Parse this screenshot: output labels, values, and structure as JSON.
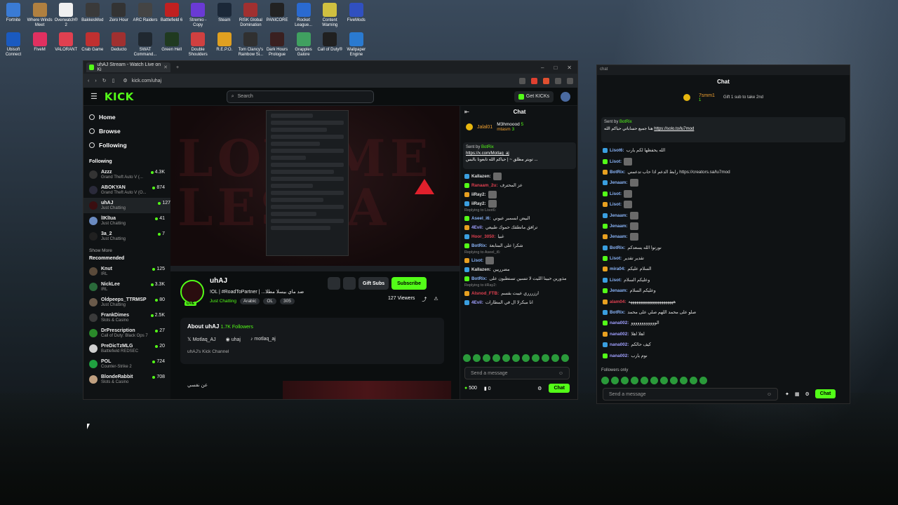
{
  "desktop": {
    "icons": [
      {
        "label": "Fortnite",
        "color": "#3a7bd5"
      },
      {
        "label": "Where Winds Meet",
        "color": "#b08040"
      },
      {
        "label": "Overwatch® 2",
        "color": "#f0f0f0"
      },
      {
        "label": "BakkesMod",
        "color": "#3a3a3a"
      },
      {
        "label": "Zero Hour",
        "color": "#333"
      },
      {
        "label": "ARC Raiders",
        "color": "#444"
      },
      {
        "label": "Battlefield 6",
        "color": "#c02020"
      },
      {
        "label": "Stremio - Copy",
        "color": "#6a3ad5"
      },
      {
        "label": "Steam",
        "color": "#1b2838"
      },
      {
        "label": "RISK Global Domination",
        "color": "#a03030"
      },
      {
        "label": "PANICORE",
        "color": "#222"
      },
      {
        "label": "Rocket League...",
        "color": "#2a6ad0"
      },
      {
        "label": "Content Warning",
        "color": "#d0c040"
      },
      {
        "label": "FiveMods",
        "color": "#3050c0"
      },
      {
        "label": "Ubisoft Connect",
        "color": "#1a5ac0"
      },
      {
        "label": "FiveM",
        "color": "#e03060"
      },
      {
        "label": "VALORANT",
        "color": "#e04050"
      },
      {
        "label": "Crab Game",
        "color": "#c03030"
      },
      {
        "label": "Deducto",
        "color": "#a03030"
      },
      {
        "label": "SWAT Command...",
        "color": "#202830"
      },
      {
        "label": "Green Hell",
        "color": "#203a20"
      },
      {
        "label": "Double Shoulders",
        "color": "#d04040"
      },
      {
        "label": "R.E.P.O.",
        "color": "#e0a020"
      },
      {
        "label": "Tom Clancy's Rainbow Si...",
        "color": "#303030"
      },
      {
        "label": "Dark Hours Prologue",
        "color": "#3a2020"
      },
      {
        "label": "Grapples Galore",
        "color": "#40a060"
      },
      {
        "label": "Call of Duty®",
        "color": "#202020"
      },
      {
        "label": "Wallpaper Engine",
        "color": "#2a7ad0"
      }
    ]
  },
  "browser": {
    "tab_title": "uhAJ Stream - Watch Live on Ki",
    "url": "kick.com/uhaj",
    "logo": "KICK",
    "search_placeholder": "Search",
    "get_kicks": "Get KICKs",
    "nav": [
      {
        "label": "Home"
      },
      {
        "label": "Browse"
      },
      {
        "label": "Following"
      }
    ],
    "following_header": "Following",
    "following": [
      {
        "name": "Azzz",
        "game": "Grand Theft Auto V (...",
        "viewers": "4.3K",
        "color": "#333"
      },
      {
        "name": "ABOKYAN",
        "game": "Grand Theft Auto V (O...",
        "viewers": "874",
        "color": "#2a2a3a"
      },
      {
        "name": "uhAJ",
        "game": "Just Chatting",
        "viewers": "127",
        "color": "#3a0e10"
      },
      {
        "name": "lIKlIua",
        "game": "Just Chatting",
        "viewers": "41",
        "color": "#6a8ac0"
      },
      {
        "name": "3a_2",
        "game": "Just Chatting",
        "viewers": "7",
        "color": "#202020"
      }
    ],
    "show_more": "Show More",
    "recommended_header": "Recommended",
    "recommended": [
      {
        "name": "Knut",
        "game": "IRL",
        "viewers": "125",
        "color": "#5a4a3a"
      },
      {
        "name": "NickLee",
        "game": "IRL",
        "viewers": "3.3K",
        "color": "#2a6a3a"
      },
      {
        "name": "Oldpeeps_TTRMSP",
        "game": "Just Chatting",
        "viewers": "80",
        "color": "#6a5a4a"
      },
      {
        "name": "FrankDimes",
        "game": "Slots & Casino",
        "viewers": "2.5K",
        "color": "#3a3a3a"
      },
      {
        "name": "DrPrescription",
        "game": "Call of Duty: Black Ops 7",
        "viewers": "27",
        "color": "#2a8a2a"
      },
      {
        "name": "PreDicTzMLG",
        "game": "Battlefield REDSEC",
        "viewers": "20",
        "color": "#d0d0d0"
      },
      {
        "name": "POL",
        "game": "Counter-Strike 2",
        "viewers": "724",
        "color": "#20a040"
      },
      {
        "name": "BlondeRabbit",
        "game": "Slots & Casino",
        "viewers": "708",
        "color": "#c0a080"
      }
    ],
    "stream": {
      "name": "uhAJ",
      "live": "LIVE",
      "title": "!OL | #RoadToPartner | ...ضد ماي بيسلا مطلا",
      "category": "Just Chatting",
      "tags": [
        "Arabic",
        "OL",
        "305"
      ],
      "viewers": "127 Viewers",
      "gift_subs": "Gift Subs",
      "subscribe": "Subscribe",
      "watermark": "LOV ME LESRA"
    },
    "about": {
      "title": "About uhAJ",
      "followers": "1.7K Followers",
      "socials": [
        "Motlaq_AJ",
        "uhaj",
        "motlaq_aj"
      ],
      "desc": "uhAJ's Kick Channel"
    },
    "below_label": "عن نفسي",
    "chat": {
      "title": "Chat",
      "top_gifters": [
        {
          "name": "Jalal01",
          "count": "5"
        },
        {
          "name": "M3hmoood",
          "count": "5"
        },
        {
          "name": "mtasm",
          "count": "3"
        }
      ],
      "pinned_by": "Sent by",
      "pinned_user": "BotRix",
      "pinned_link": "https://x.com/Motlaq_aj",
      "pinned_text": "تويتر مطلق ~ | حياكم الله تابعونا بالبس ...",
      "messages": [
        {
          "user": "Kallazen:",
          "text": "",
          "color": "#e0e0e0",
          "reply": ""
        },
        {
          "user": "Ranaam_2u:",
          "text": "عز المحترف",
          "color": "#e04050",
          "reply": ""
        },
        {
          "user": "iiRay2:",
          "text": "",
          "color": "#e0e0e0",
          "reply": ""
        },
        {
          "user": "iiRay2:",
          "text": "",
          "color": "#e0e0e0",
          "reply": ""
        },
        {
          "user": "Aseel_i6:",
          "text": "البيض ابسمبر عيوني",
          "color": "#8ab4f8",
          "reply": "Replying to Lisot6:"
        },
        {
          "user": "4Evil:",
          "text": "ترافق مانطقك حموك طبيعي",
          "color": "#a0a0ff",
          "reply": ""
        },
        {
          "user": "Hoor_3050:",
          "text": "غبيا",
          "color": "#e04050",
          "reply": ""
        },
        {
          "user": "BotRix:",
          "text": "شكرا على المتابعة",
          "color": "#8ab4f8",
          "reply": ""
        },
        {
          "user": "Lisot:",
          "text": "",
          "color": "#8ab4f8",
          "reply": "Replying to Aseel_i6:"
        },
        {
          "user": "Kallazen:",
          "text": "مضرريين",
          "color": "#e0e0e0",
          "reply": ""
        },
        {
          "user": "BotRix:",
          "text": "مذورين حبينا الليت لا تنسين تستطبون على",
          "color": "#8ab4f8",
          "reply": ""
        },
        {
          "user": "Alsnod_FTB:",
          "text": "ارزررري عيبت بقسم",
          "color": "#e04050",
          "reply": "Replying to iiRay2:"
        },
        {
          "user": "4Evil:",
          "text": "انا مبكرلا ال في المطارات",
          "color": "#a0a0ff",
          "reply": ""
        }
      ],
      "send_placeholder": "Send a message",
      "kicks": "500",
      "points": "0",
      "chat_button": "Chat"
    }
  },
  "popout": {
    "title": "Chat",
    "top_gifter": {
      "name": "7smm1",
      "count": "1",
      "goal": "Gift 1 sub to take 2nd"
    },
    "pinned_by": "Sent by",
    "pinned_user": "BotRix",
    "pinned_text": "هنا جميع حساباتي حياكم الله",
    "pinned_link": "https://solo.to/lu7mod",
    "messages": [
      {
        "user": "Lisot6:",
        "text": "الله يحفظها لكم يارب",
        "color": "#8ab4f8"
      },
      {
        "user": "Lisot:",
        "text": "",
        "color": "#8ab4f8"
      },
      {
        "user": "BotRix:",
        "text": "رابط الدعم اذا حاب تدعمني https://creators.sa/lu7mod",
        "color": "#8ab4f8"
      },
      {
        "user": "Jenaam:",
        "text": "",
        "color": "#8ab4f8"
      },
      {
        "user": "Lisot:",
        "text": "",
        "color": "#8ab4f8"
      },
      {
        "user": "Lisot:",
        "text": "",
        "color": "#8ab4f8"
      },
      {
        "user": "Jenaam:",
        "text": "",
        "color": "#8ab4f8"
      },
      {
        "user": "Jenaam:",
        "text": "",
        "color": "#8ab4f8"
      },
      {
        "user": "Jenaam:",
        "text": "",
        "color": "#8ab4f8"
      },
      {
        "user": "BotRix:",
        "text": "نورتوا الله يسعدكم",
        "color": "#8ab4f8"
      },
      {
        "user": "Lisot:",
        "text": "تقدير تقدير",
        "color": "#8ab4f8"
      },
      {
        "user": "mira04:",
        "text": "السلام عليكم",
        "color": "#8ab4f8"
      },
      {
        "user": "Lisot:",
        "text": "وعليكم السلام",
        "color": "#8ab4f8"
      },
      {
        "user": "Jenaam:",
        "text": "وعليكم السلام",
        "color": "#8ab4f8"
      },
      {
        "user": "alam04:",
        "text": "ههههههههههههههههههههههه",
        "color": "#e04050"
      },
      {
        "user": "BotRix:",
        "text": "صلو على محمد اللهم صلي على محمد",
        "color": "#8ab4f8"
      },
      {
        "user": "nana002:",
        "text": "الوووووووووووو",
        "color": "#a0a0ff"
      },
      {
        "user": "nana002:",
        "text": "اهلا اهلا",
        "color": "#a0a0ff"
      },
      {
        "user": "nana002:",
        "text": "كيف حالكم",
        "color": "#a0a0ff"
      },
      {
        "user": "nana002:",
        "text": "نوم يارب",
        "color": "#a0a0ff"
      }
    ],
    "followers_only": "Followers only",
    "send_placeholder": "Send a message",
    "chat_button": "Chat"
  }
}
